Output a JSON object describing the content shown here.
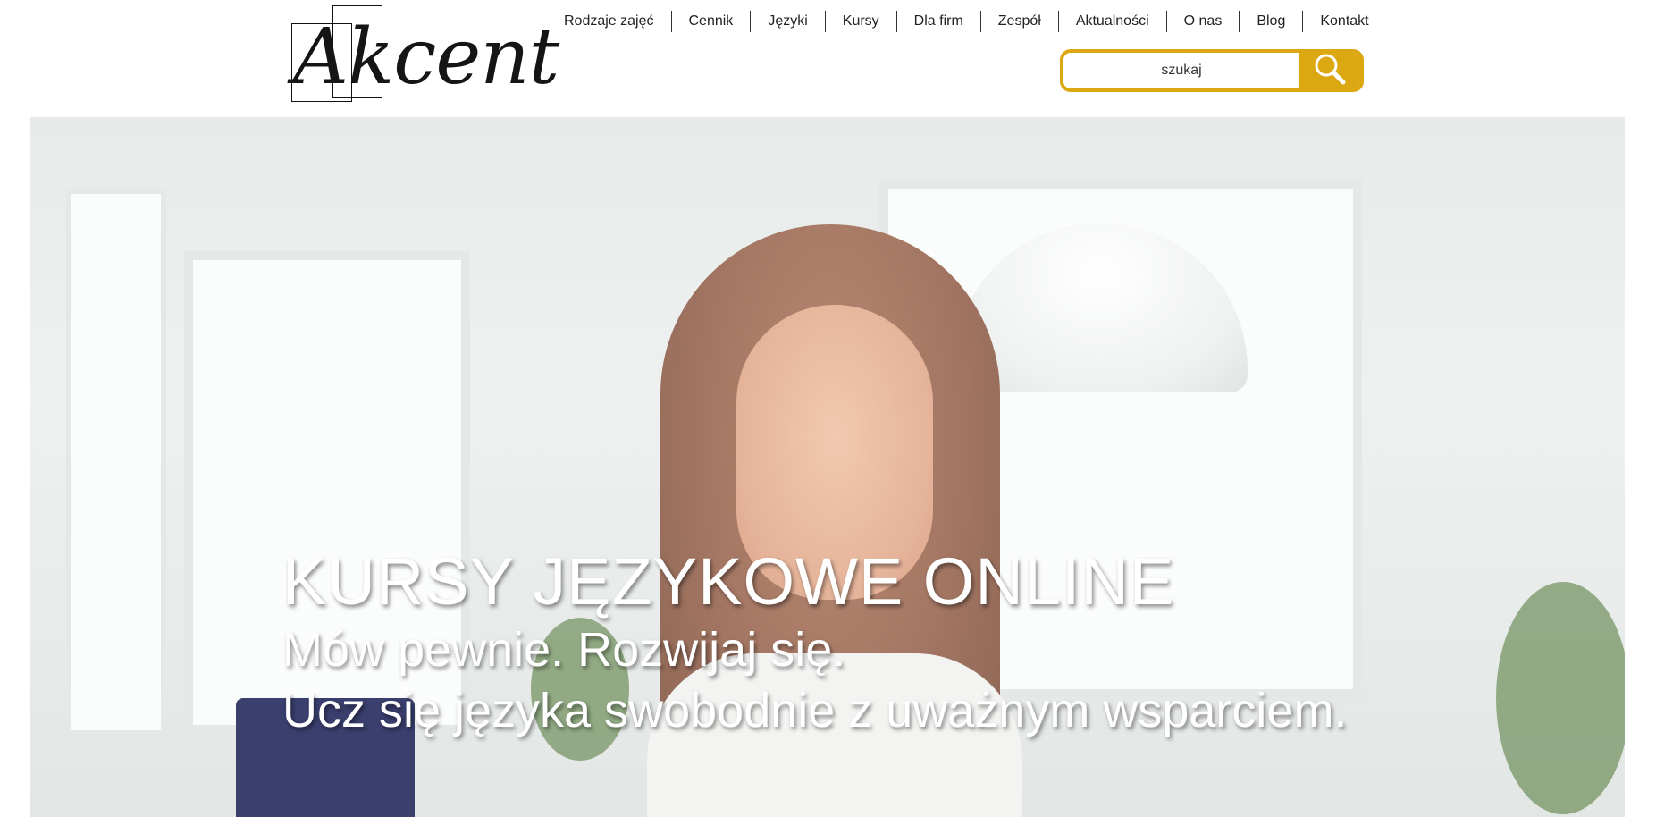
{
  "brand": {
    "logo_text": "Akcent"
  },
  "nav": {
    "items": [
      "Rodzaje zajęć",
      "Cennik",
      "Języki",
      "Kursy",
      "Dla firm",
      "Zespół",
      "Aktualności",
      "O nas",
      "Blog",
      "Kontakt"
    ]
  },
  "search": {
    "placeholder": "szukaj",
    "icon": "search-icon"
  },
  "hero": {
    "title": "KURSY JĘZYKOWE ONLINE",
    "line1": "Mów pewnie. Rozwijaj się.",
    "line2": "Ucz się języka swobodnie z uważnym wsparciem."
  },
  "colors": {
    "accent": "#dca812",
    "text": "#222222"
  }
}
